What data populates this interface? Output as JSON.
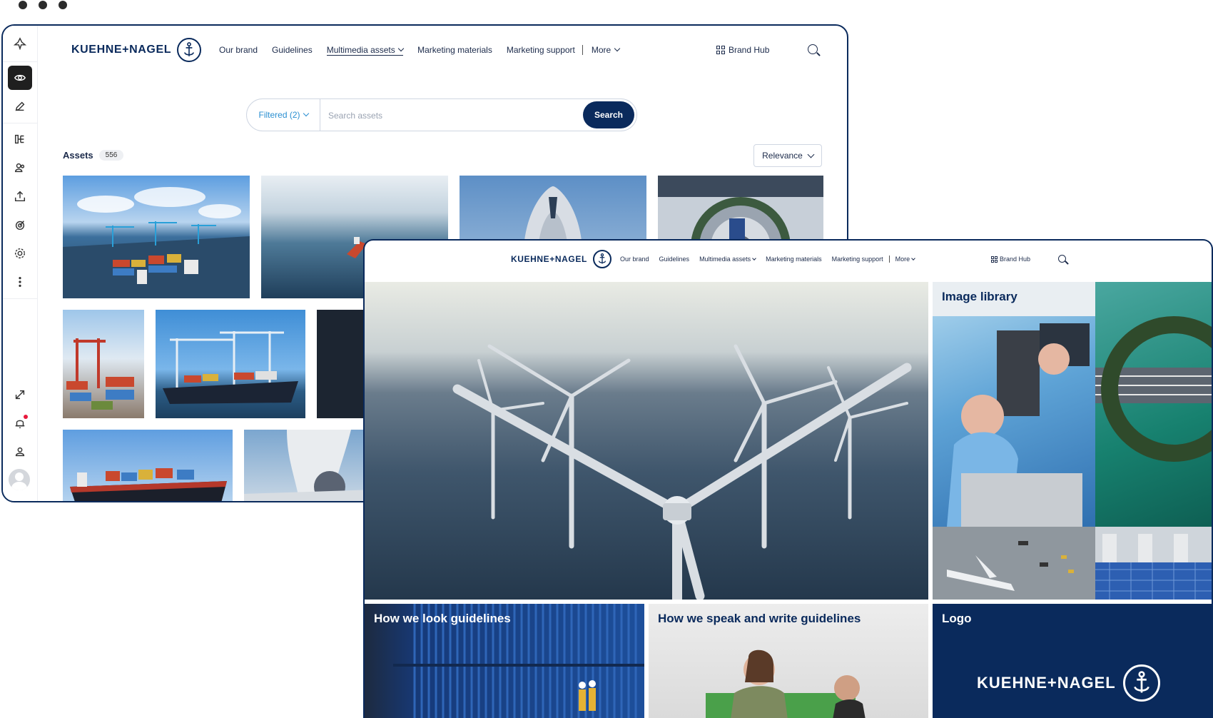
{
  "back_window": {
    "brand": "KUEHNE+NAGEL",
    "nav": {
      "items": [
        "Our brand",
        "Guidelines",
        "Multimedia assets",
        "Marketing materials",
        "Marketing support",
        "More"
      ],
      "brand_hub": "Brand Hub"
    },
    "search": {
      "filter_label": "Filtered (2)",
      "placeholder": "Search assets",
      "button": "Search"
    },
    "assets": {
      "label": "Assets",
      "count": "556",
      "sort": "Relevance"
    }
  },
  "front_window": {
    "brand": "KUEHNE+NAGEL",
    "nav": {
      "items": [
        "Our brand",
        "Guidelines",
        "Multimedia assets",
        "Marketing materials",
        "Marketing support",
        "More"
      ],
      "brand_hub": "Brand Hub"
    },
    "panels": {
      "image_library": "Image library",
      "how_we_look": "How we look guidelines",
      "how_we_speak": "How we speak and write guidelines",
      "logo": "Logo",
      "logo_brand": "KUEHNE+NAGEL"
    }
  },
  "colors": {
    "brand_navy": "#0a2a5c",
    "accent_blue": "#2a8fd1"
  }
}
